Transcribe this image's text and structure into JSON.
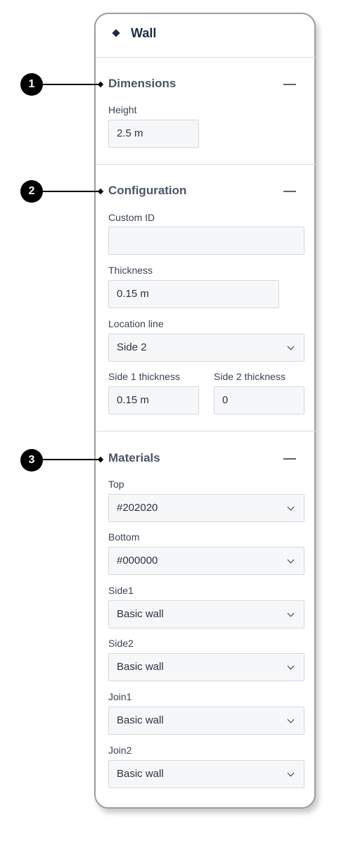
{
  "panel": {
    "title": "Wall"
  },
  "callouts": [
    "1",
    "2",
    "3"
  ],
  "sections": {
    "dimensions": {
      "title": "Dimensions",
      "height_label": "Height",
      "height_value": "2.5 m"
    },
    "configuration": {
      "title": "Configuration",
      "custom_id_label": "Custom ID",
      "custom_id_value": "",
      "thickness_label": "Thickness",
      "thickness_value": "0.15 m",
      "location_line_label": "Location line",
      "location_line_value": "Side 2",
      "side1_thickness_label": "Side 1 thickness",
      "side1_thickness_value": "0.15 m",
      "side2_thickness_label": "Side 2 thickness",
      "side2_thickness_value": "0"
    },
    "materials": {
      "title": "Materials",
      "top_label": "Top",
      "top_value": "#202020",
      "bottom_label": "Bottom",
      "bottom_value": "#000000",
      "side1_label": "Side1",
      "side1_value": "Basic wall",
      "side2_label": "Side2",
      "side2_value": "Basic wall",
      "join1_label": "Join1",
      "join1_value": "Basic wall",
      "join2_label": "Join2",
      "join2_value": "Basic wall"
    }
  },
  "icons": {
    "title_icon": "diamond-icon",
    "collapse_icon": "minus-icon",
    "dropdown_icon": "chevron-down-icon"
  },
  "colors": {
    "title": "#1f2a44",
    "section_title": "#4b5565",
    "field_background": "#f6f7f9",
    "callout": "#000000"
  }
}
